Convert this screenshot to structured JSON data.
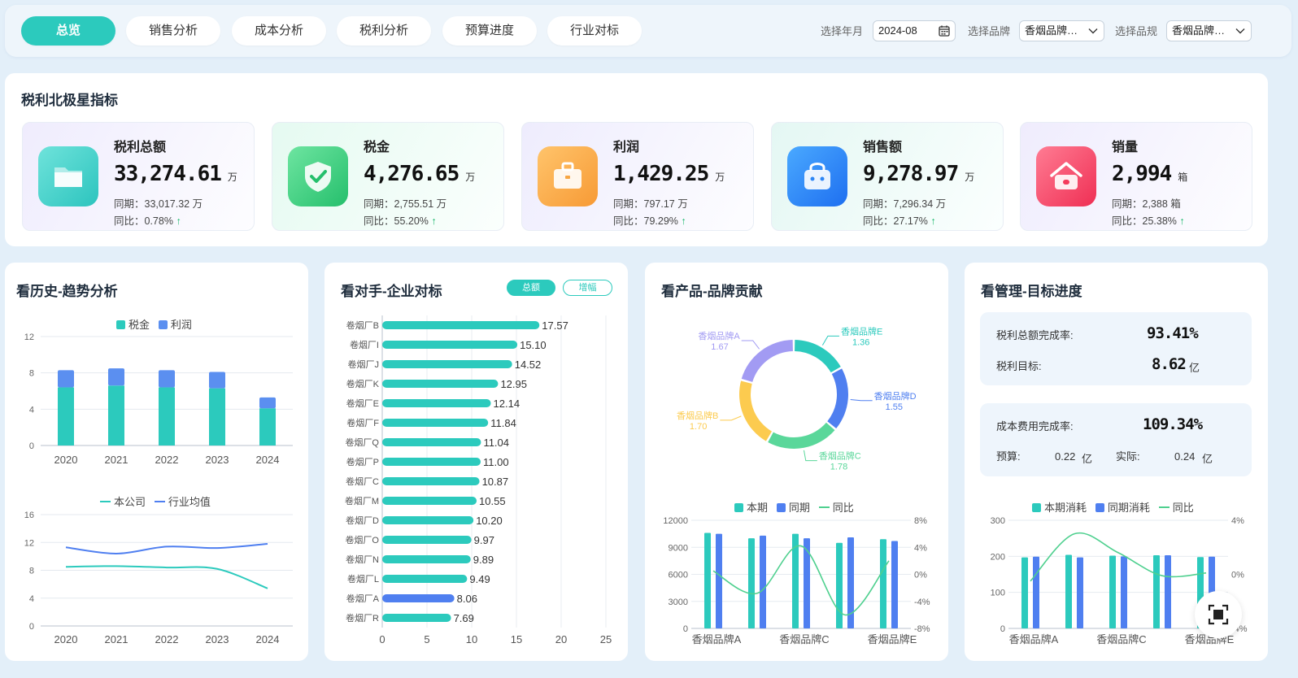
{
  "tabs": [
    {
      "label": "总览",
      "active": true
    },
    {
      "label": "销售分析",
      "active": false
    },
    {
      "label": "成本分析",
      "active": false
    },
    {
      "label": "税利分析",
      "active": false
    },
    {
      "label": "预算进度",
      "active": false
    },
    {
      "label": "行业对标",
      "active": false
    }
  ],
  "filters": {
    "year_label": "选择年月",
    "year_value": "2024-08",
    "brand_label": "选择品牌",
    "brand_value": "香烟品牌…",
    "spec_label": "选择品规",
    "spec_value": "香烟品牌…"
  },
  "north_star": {
    "title": "税利北极星指标",
    "kpis": [
      {
        "name": "税利总额",
        "value": "33,274.61",
        "unit": "万",
        "prev": "同期：33,017.32 万",
        "yoy": "同比：0.78%",
        "icon": "folder-icon",
        "color": "#3dd0c7"
      },
      {
        "name": "税金",
        "value": "4,276.65",
        "unit": "万",
        "prev": "同期：2,755.51 万",
        "yoy": "同比：55.20%",
        "icon": "shield-check-icon",
        "color": "#35c779"
      },
      {
        "name": "利润",
        "value": "1,429.25",
        "unit": "万",
        "prev": "同期：797.17 万",
        "yoy": "同比：79.29%",
        "icon": "briefcase-icon",
        "color": "#f7a642"
      },
      {
        "name": "销售额",
        "value": "9,278.97",
        "unit": "万",
        "prev": "同期：7,296.34 万",
        "yoy": "同比：27.17%",
        "icon": "shopping-bag-icon",
        "color": "#2d86f6"
      },
      {
        "name": "销量",
        "value": "2,994",
        "unit": "箱",
        "prev": "同期：2,388 箱",
        "yoy": "同比：25.38%",
        "icon": "house-icon",
        "color": "#f43b5b"
      }
    ]
  },
  "history": {
    "title": "看历史-趋势分析"
  },
  "rival": {
    "title": "看对手-企业对标",
    "toggle_total": "总额",
    "toggle_growth": "增幅"
  },
  "product": {
    "title": "看产品-品牌贡献"
  },
  "management": {
    "title": "看管理-目标进度",
    "tax_rate_label": "税利总额完成率:",
    "tax_rate_value": "93.41%",
    "tax_target_label": "税利目标:",
    "tax_target_value": "8.62",
    "tax_target_unit": "亿",
    "cost_rate_label": "成本费用完成率:",
    "cost_rate_value": "109.34%",
    "budget_label": "预算:",
    "budget_value": "0.22",
    "budget_unit": "亿",
    "actual_label": "实际:",
    "actual_value": "0.24",
    "actual_unit": "亿"
  },
  "chart_data": [
    {
      "id": "history-bars",
      "type": "bar",
      "stacked": true,
      "categories": [
        "2020",
        "2021",
        "2022",
        "2023",
        "2024"
      ],
      "series": [
        {
          "name": "税金",
          "values": [
            6.4,
            6.6,
            6.4,
            6.3,
            4.1
          ],
          "color": "#2ccabd"
        },
        {
          "name": "利润",
          "values": [
            1.9,
            1.9,
            1.9,
            1.8,
            1.2
          ],
          "color": "#5b8ff0"
        }
      ],
      "ylim": [
        0,
        12
      ],
      "yticks": [
        0,
        4,
        8,
        12
      ],
      "legend": "top-center"
    },
    {
      "id": "history-lines",
      "type": "line",
      "categories": [
        "2020",
        "2021",
        "2022",
        "2023",
        "2024"
      ],
      "series": [
        {
          "name": "本公司",
          "values": [
            8.5,
            8.6,
            8.4,
            8.2,
            5.4
          ],
          "color": "#2ccabd"
        },
        {
          "name": "行业均值",
          "values": [
            11.3,
            10.4,
            11.4,
            11.2,
            11.8
          ],
          "color": "#4f7ff0"
        }
      ],
      "ylim": [
        0,
        16
      ],
      "yticks": [
        0,
        4,
        8,
        12,
        16
      ],
      "legend": "top-center"
    },
    {
      "id": "rival-bars",
      "type": "bar",
      "orientation": "horizontal",
      "categories": [
        "卷烟厂B",
        "卷烟厂I",
        "卷烟厂J",
        "卷烟厂K",
        "卷烟厂E",
        "卷烟厂F",
        "卷烟厂Q",
        "卷烟厂P",
        "卷烟厂C",
        "卷烟厂M",
        "卷烟厂D",
        "卷烟厂O",
        "卷烟厂N",
        "卷烟厂L",
        "卷烟厂A",
        "卷烟厂R"
      ],
      "values": [
        17.57,
        15.1,
        14.52,
        12.95,
        12.14,
        11.84,
        11.04,
        11.0,
        10.87,
        10.55,
        10.2,
        9.97,
        9.89,
        9.49,
        8.06,
        7.69
      ],
      "labels": [
        "17.57",
        "15.10",
        "14.52",
        "12.95",
        "12.14",
        "11.84",
        "11.04",
        "11.00",
        "10.87",
        "10.55",
        "10.20",
        "9.97",
        "9.89",
        "9.49",
        "8.06",
        "7.69"
      ],
      "highlight": "卷烟厂A",
      "color": "#2ccabd",
      "highlight_color": "#4f7ff0",
      "xlim": [
        0,
        25
      ],
      "xticks": [
        0,
        5,
        10,
        15,
        20,
        25
      ]
    },
    {
      "id": "brand-donut",
      "type": "pie",
      "donut": true,
      "slices": [
        {
          "name": "香烟品牌E",
          "value": 1.36,
          "label": "1.36",
          "color": "#2ccabd"
        },
        {
          "name": "香烟品牌D",
          "value": 1.55,
          "label": "1.55",
          "color": "#4f7ff0"
        },
        {
          "name": "香烟品牌C",
          "value": 1.78,
          "label": "1.78",
          "color": "#5ad79a"
        },
        {
          "name": "香烟品牌B",
          "value": 1.7,
          "label": "1.70",
          "color": "#fccb4f"
        },
        {
          "name": "香烟品牌A",
          "value": 1.67,
          "label": "1.67",
          "color": "#a29bf3"
        }
      ]
    },
    {
      "id": "brand-combo",
      "type": "bar",
      "categories": [
        "香烟品牌A",
        "香烟品牌B",
        "香烟品牌C",
        "香烟品牌D",
        "香烟品牌E"
      ],
      "xtick_labels": [
        "香烟品牌A",
        "",
        "香烟品牌C",
        "",
        "香烟品牌E"
      ],
      "series": [
        {
          "name": "本期",
          "kind": "bar",
          "values": [
            10600,
            10000,
            10500,
            9500,
            9900
          ],
          "color": "#2ccabd"
        },
        {
          "name": "同期",
          "kind": "bar",
          "values": [
            10500,
            10300,
            10000,
            10100,
            9700
          ],
          "color": "#4f7ff0"
        },
        {
          "name": "同比",
          "kind": "line",
          "axis": "right",
          "values": [
            0.5,
            -2.8,
            4.2,
            -6.0,
            2.0
          ],
          "color": "#4fd08f"
        }
      ],
      "ylim": [
        0,
        12000
      ],
      "yticks": [
        0,
        3000,
        6000,
        9000,
        12000
      ],
      "y2lim": [
        -8,
        8
      ],
      "y2ticks": [
        "-8%",
        "-4%",
        "0%",
        "4%",
        "8%"
      ],
      "legend": "top-center"
    },
    {
      "id": "cost-combo",
      "type": "bar",
      "categories": [
        "香烟品牌A",
        "香烟品牌B",
        "香烟品牌C",
        "香烟品牌D",
        "香烟品牌E"
      ],
      "xtick_labels": [
        "香烟品牌A",
        "",
        "香烟品牌C",
        "",
        "香烟品牌E"
      ],
      "series": [
        {
          "name": "本期消耗",
          "kind": "bar",
          "values": [
            197,
            204,
            202,
            203,
            198
          ],
          "color": "#2ccabd"
        },
        {
          "name": "同期消耗",
          "kind": "bar",
          "values": [
            199,
            197,
            200,
            203,
            199
          ],
          "color": "#4f7ff0"
        },
        {
          "name": "同比",
          "kind": "line",
          "axis": "right",
          "values": [
            -0.5,
            3.0,
            1.6,
            -0.1,
            0.1
          ],
          "color": "#4fd08f"
        }
      ],
      "ylim": [
        0,
        300
      ],
      "yticks": [
        0,
        100,
        200,
        300
      ],
      "y2lim": [
        -4,
        4
      ],
      "y2ticks": [
        "-4%",
        "0%",
        "4%"
      ],
      "legend": "top-center"
    }
  ]
}
